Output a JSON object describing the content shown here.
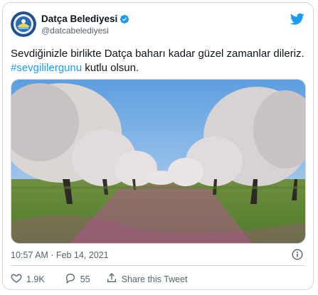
{
  "tweet": {
    "display_name": "Datça Belediyesi",
    "handle": "@datcabelediyesi",
    "text_line1": "Sevdiğinizle birlikte Datça baharı kadar güzel zamanlar dileriz.",
    "hashtag": "#sevgililergunu",
    "text_after_hashtag": " kutlu olsun.",
    "timestamp": "10:57 AM · Feb 14, 2021",
    "likes": "1.9K",
    "replies": "55",
    "share_label": "Share this Tweet"
  },
  "colors": {
    "accent": "#1d9bf0",
    "text": "#0f1419",
    "secondary": "#536471",
    "border": "#cfd9de"
  },
  "icons": [
    "verified-badge-icon",
    "twitter-bird-icon",
    "info-icon",
    "heart-icon",
    "reply-icon",
    "share-icon"
  ]
}
